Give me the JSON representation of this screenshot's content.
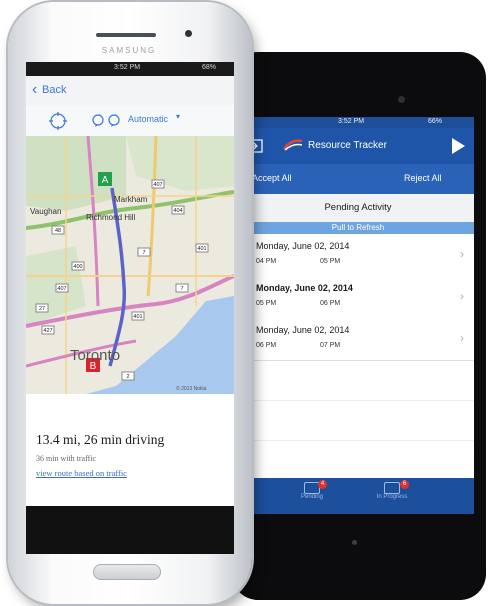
{
  "phone": {
    "brand": "SAMSUNG",
    "status_time": "3:52 PM",
    "status_battery": "68%",
    "back_label": "Back",
    "route_mode": "Automatic",
    "map": {
      "marker_start": "A",
      "marker_end": "B",
      "labels": [
        "Vaughan",
        "Markham",
        "Richmond Hill",
        "Toronto"
      ],
      "highway_shields": [
        "407",
        "404",
        "48",
        "401",
        "7",
        "7",
        "407",
        "400",
        "27",
        "427",
        "401",
        "2"
      ],
      "attribution": "© 2013 Nokia"
    },
    "route_summary": "13.4 mi, 26 min driving",
    "route_traffic": "36 min with traffic",
    "route_link": "view route based on traffic",
    "colors": {
      "route": "#5b63c9",
      "marker_start": "#22a04b",
      "marker_end": "#d8252c",
      "water": "#a9c8ee"
    }
  },
  "tablet": {
    "status_time": "3:52 PM",
    "status_battery": "66%",
    "title": "Resource Tracker",
    "accept_all": "Accept All",
    "reject_all": "Reject All",
    "section_title": "Pending Activity",
    "pull_refresh": "Pull to Refresh",
    "activities": [
      {
        "date": "Monday, June 02, 2014",
        "start": "04 PM",
        "end": "05 PM"
      },
      {
        "date": "Monday, June 02, 2014",
        "start": "05 PM",
        "end": "06 PM"
      },
      {
        "date": "Monday, June 02, 2014",
        "start": "06 PM",
        "end": "07 PM"
      }
    ],
    "tabs": [
      {
        "label": "Pending",
        "badge": "4"
      },
      {
        "label": "In Progress",
        "badge": "6"
      }
    ],
    "colors": {
      "nav": "#1e55a8",
      "accent": "#6ea4df",
      "badge": "#e0312b"
    }
  }
}
